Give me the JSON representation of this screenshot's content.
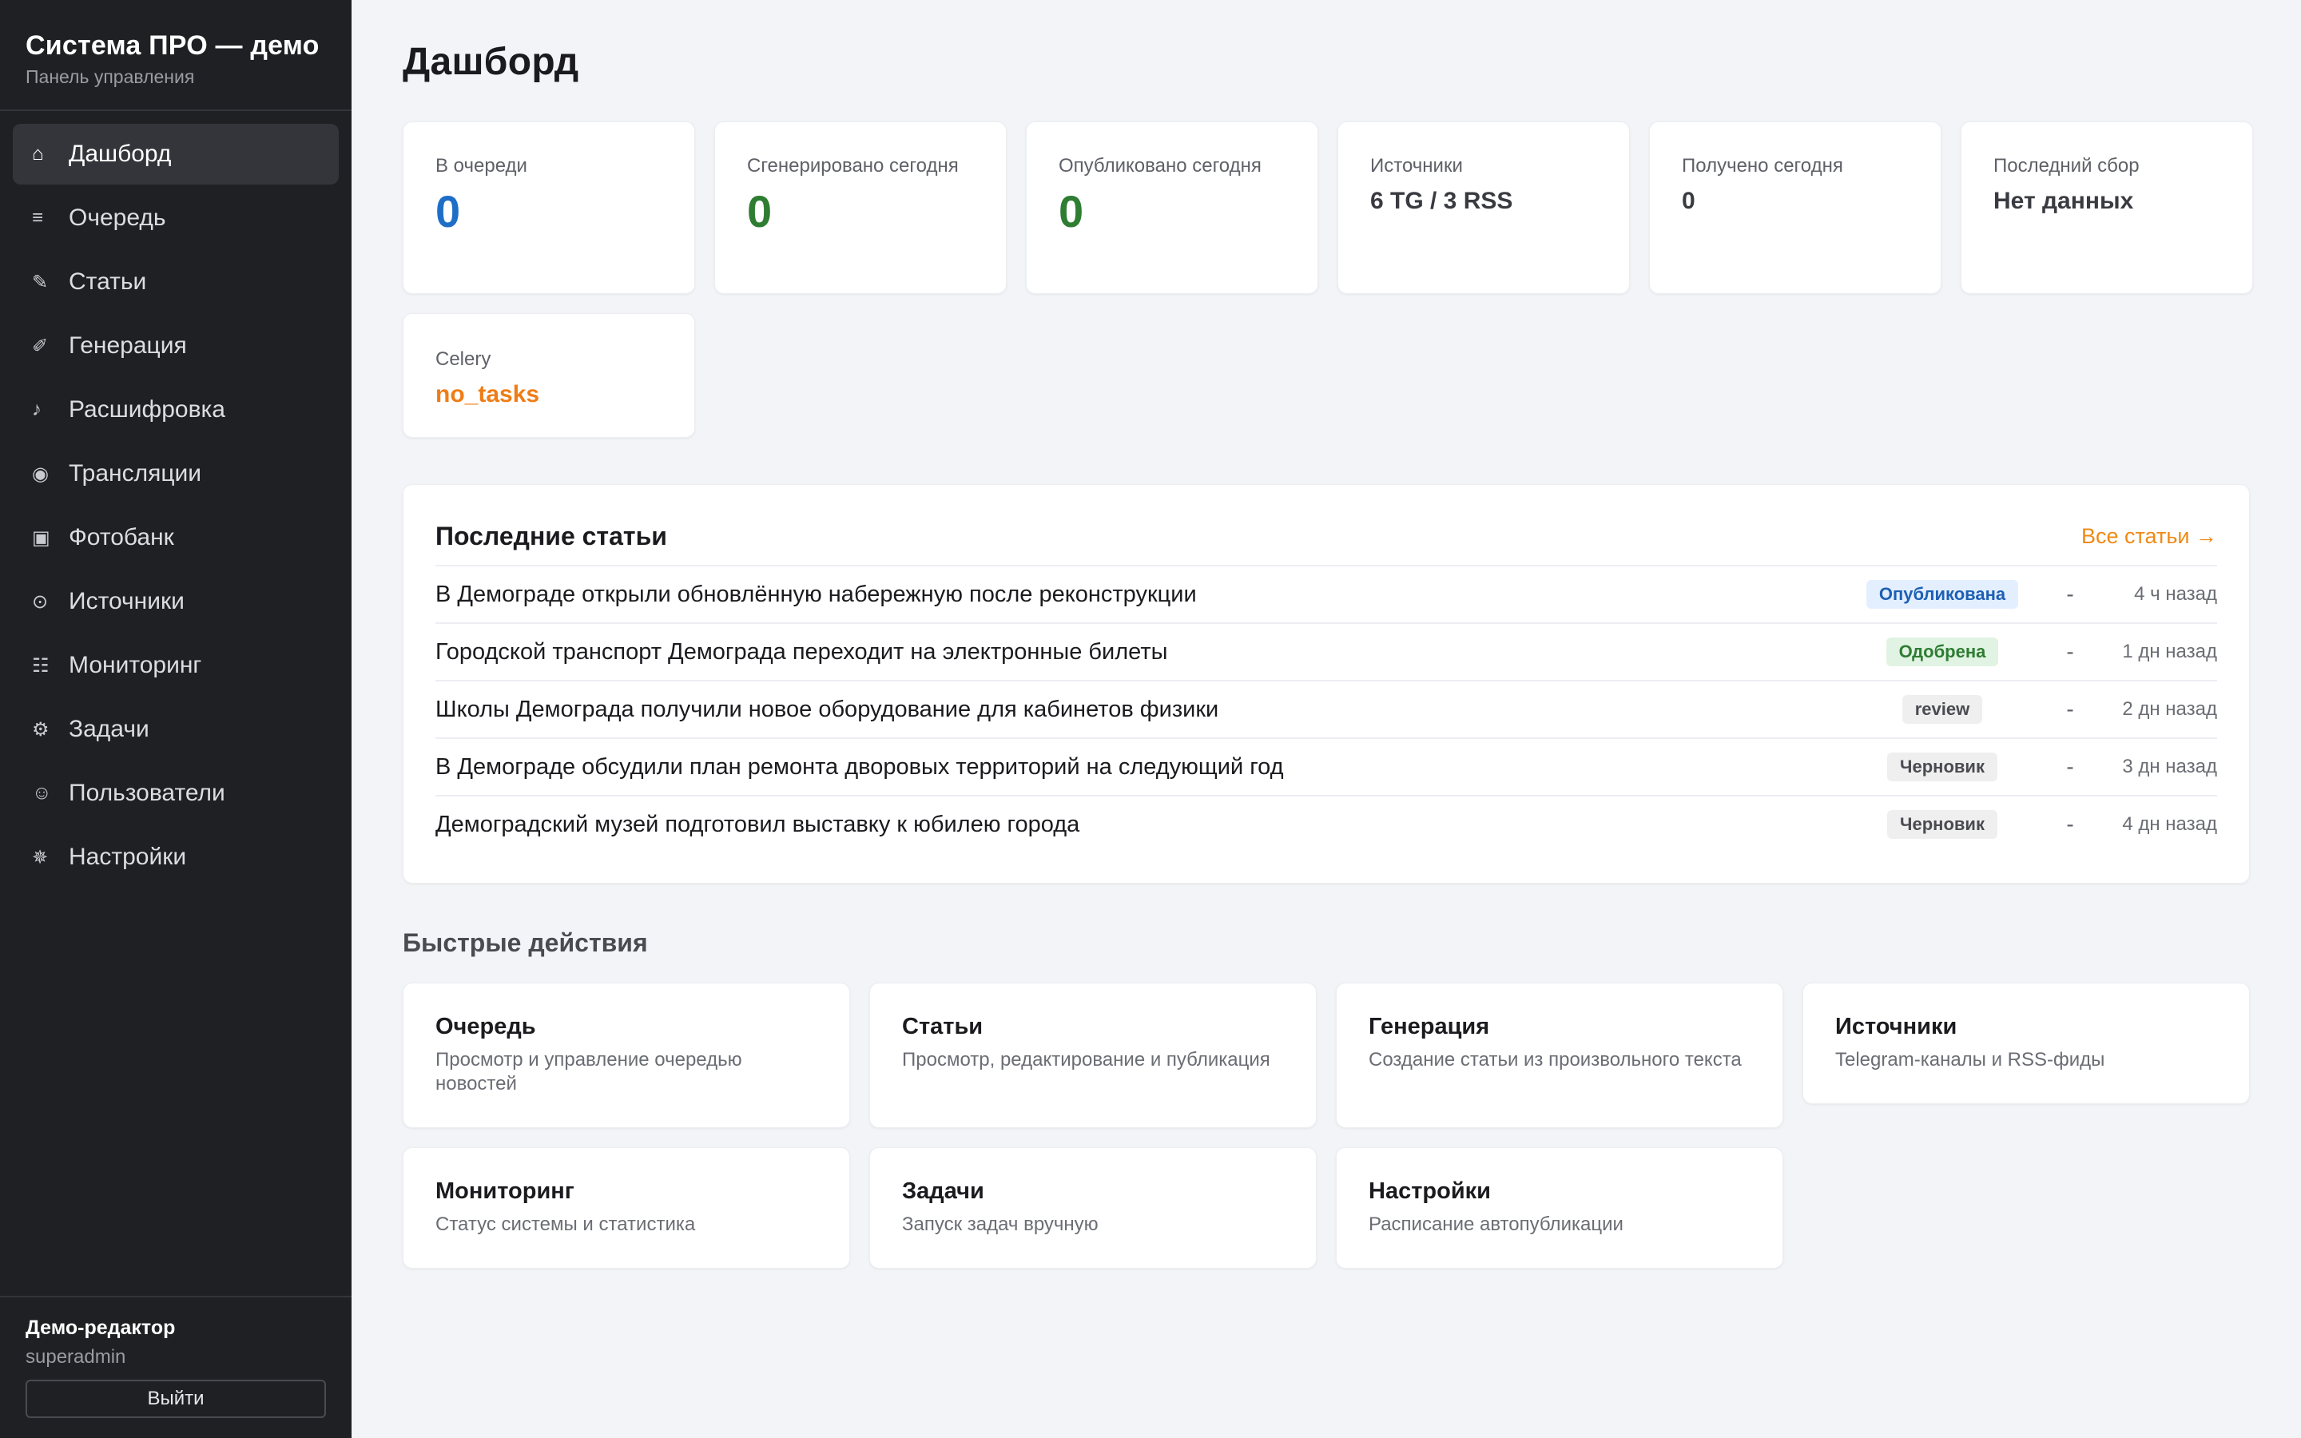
{
  "sidebar": {
    "title": "Система ПРО — демо",
    "subtitle": "Панель управления",
    "items": [
      {
        "label": "Дашборд",
        "icon": "home-icon",
        "glyph": "⌂"
      },
      {
        "label": "Очередь",
        "icon": "list-icon",
        "glyph": "≡"
      },
      {
        "label": "Статьи",
        "icon": "pencil-icon",
        "glyph": "✎"
      },
      {
        "label": "Генерация",
        "icon": "wand-icon",
        "glyph": "✐"
      },
      {
        "label": "Расшифровка",
        "icon": "music-note-icon",
        "glyph": "♪"
      },
      {
        "label": "Трансляции",
        "icon": "broadcast-icon",
        "glyph": "◉"
      },
      {
        "label": "Фотобанк",
        "icon": "image-icon",
        "glyph": "▣"
      },
      {
        "label": "Источники",
        "icon": "source-icon",
        "glyph": "⊙"
      },
      {
        "label": "Мониторинг",
        "icon": "monitoring-icon",
        "glyph": "☷"
      },
      {
        "label": "Задачи",
        "icon": "gear-icon",
        "glyph": "⚙"
      },
      {
        "label": "Пользователи",
        "icon": "user-icon",
        "glyph": "☺"
      },
      {
        "label": "Настройки",
        "icon": "settings-icon",
        "glyph": "✵"
      }
    ],
    "user": {
      "name": "Демо-редактор",
      "role": "superadmin"
    },
    "logout_label": "Выйти"
  },
  "page": {
    "title": "Дашборд"
  },
  "stats": [
    {
      "label": "В очереди",
      "value": "0",
      "color": "#1e6ec8"
    },
    {
      "label": "Сгенерировано сегодня",
      "value": "0",
      "color": "#2e7d32"
    },
    {
      "label": "Опубликовано сегодня",
      "value": "0",
      "color": "#2e7d32"
    },
    {
      "label": "Источники",
      "value": "6 TG / 3 RSS"
    },
    {
      "label": "Получено сегодня",
      "value": "0"
    },
    {
      "label": "Последний сбор",
      "value": "Нет данных"
    },
    {
      "label": "Celery",
      "value": "no_tasks",
      "color": "#ef7d16"
    }
  ],
  "articles": {
    "title": "Последние статьи",
    "all_link": "Все статьи →",
    "rows": [
      {
        "title": "В Демограде открыли обновлённую набережную после реконструкции",
        "status": "Опубликована",
        "dash": "-",
        "time": "4 ч назад"
      },
      {
        "title": "Городской транспорт Демограда переходит на электронные билеты",
        "status": "Одобрена",
        "dash": "-",
        "time": "1 дн назад"
      },
      {
        "title": "Школы Демограда получили новое оборудование для кабинетов физики",
        "status": "review",
        "dash": "-",
        "time": "2 дн назад"
      },
      {
        "title": "В Демограде обсудили план ремонта дворовых территорий на следующий год",
        "status": "Черновик",
        "dash": "-",
        "time": "3 дн назад"
      },
      {
        "title": "Демоградский музей подготовил выставку к юбилею города",
        "status": "Черновик",
        "dash": "-",
        "time": "4 дн назад"
      }
    ]
  },
  "quick": {
    "title": "Быстрые действия",
    "items": [
      {
        "name": "Очередь",
        "desc": "Просмотр и управление очередью новостей"
      },
      {
        "name": "Статьи",
        "desc": "Просмотр, редактирование и публикация"
      },
      {
        "name": "Генерация",
        "desc": "Создание статьи из произвольного текста"
      },
      {
        "name": "Источники",
        "desc": "Telegram-каналы и RSS-фиды"
      },
      {
        "name": "Мониторинг",
        "desc": "Статус системы и статистика"
      },
      {
        "name": "Задачи",
        "desc": "Запуск задач вручную"
      },
      {
        "name": "Настройки",
        "desc": "Расписание автопубликации"
      }
    ]
  }
}
